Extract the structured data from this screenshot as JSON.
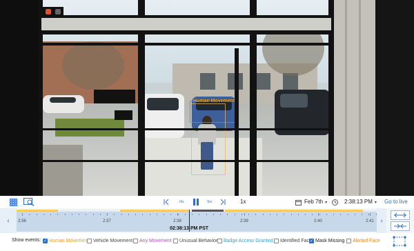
{
  "video": {
    "detections": [
      {
        "label": "Human Movement",
        "color": "#f0b24a"
      }
    ]
  },
  "controls": {
    "speed": "1x",
    "date": "Feb 7th",
    "time": "2:38:13 PM",
    "go_live_label": "Go to live",
    "skip_back_label": "5s",
    "skip_forward_label": "5s",
    "accent_color": "#2f6fc4"
  },
  "timeline": {
    "ticks": [
      "2:36",
      "2:37",
      "2:38",
      "2:39",
      "2:40",
      "2:41"
    ],
    "current_time_label": "02:38:13 PM PST",
    "playhead_fraction": 0.478
  },
  "events": {
    "title": "Show events:",
    "items": [
      {
        "label": "Human Movement",
        "checked": true,
        "color": "#f0a020"
      },
      {
        "label": "Vehicle Movement",
        "checked": false,
        "color": "#444444"
      },
      {
        "label": "Any Movement",
        "checked": false,
        "color": "#b04ec4"
      },
      {
        "label": "Unusual Behavior",
        "checked": false,
        "color": "#444444"
      },
      {
        "label": "Badge Access Granted",
        "checked": false,
        "color": "#2fa3d8"
      },
      {
        "label": "Identified Face",
        "checked": false,
        "color": "#444444"
      },
      {
        "label": "Mask Missing",
        "checked": true,
        "color": "#222222"
      },
      {
        "label": "Alerted Face",
        "checked": false,
        "color": "#e08a2a"
      }
    ]
  }
}
